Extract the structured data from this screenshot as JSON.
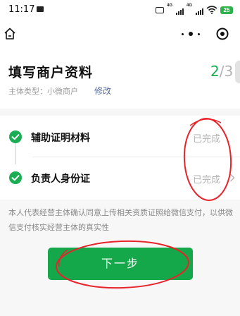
{
  "status_bar": {
    "time": "11:17",
    "signal_1_label": "4G",
    "signal_2_label": "4G",
    "battery_level": "25"
  },
  "nav": {
    "icons": [
      "home-icon",
      "more-icon",
      "close-icon"
    ]
  },
  "header": {
    "title": "填写商户资料",
    "step_current": "2",
    "step_total": "/3",
    "subject_type_label": "主体类型：小微商户",
    "modify_link": "修改"
  },
  "steps": [
    {
      "label": "辅助证明材料",
      "status": "已完成",
      "icon": "check-circle-icon"
    },
    {
      "label": "负责人身份证",
      "status": "已完成",
      "icon": "check-circle-icon",
      "chevron": "chevron-right-icon"
    }
  ],
  "disclaimer": "本人代表经营主体确认同意上传相关资质证照给微信支付，以供微信支付核实经营主体的真实性",
  "next_button_label": "下一步",
  "colors": {
    "accent_green": "#14a84a",
    "link_blue": "#576b95",
    "annotation_red": "#e8232a"
  }
}
